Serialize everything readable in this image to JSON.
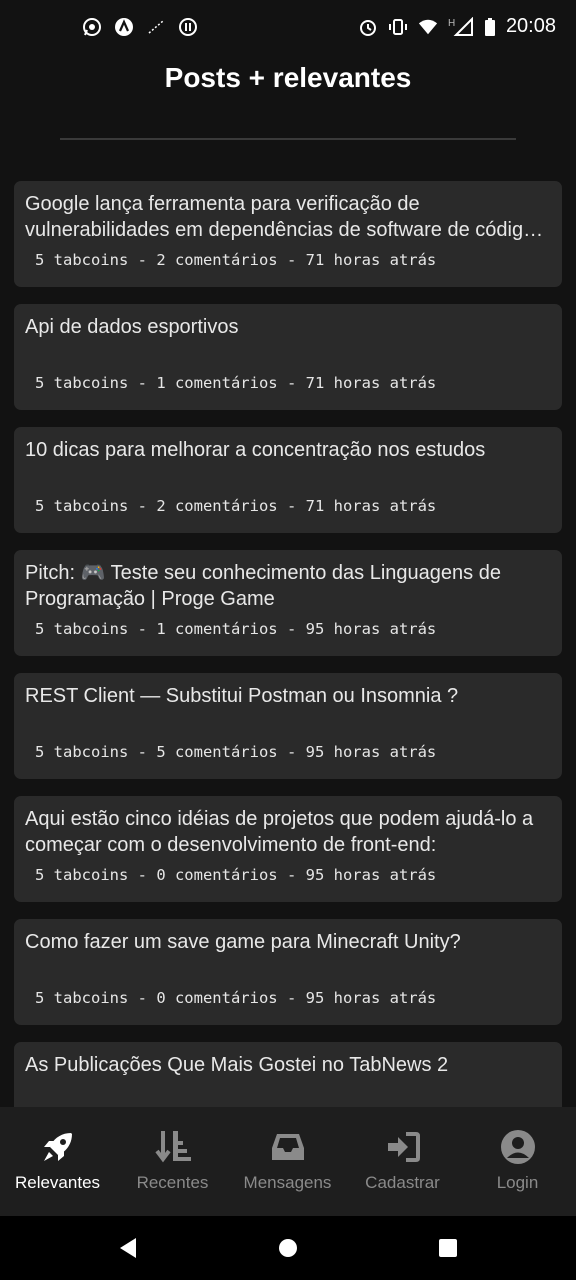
{
  "status_bar": {
    "time": "20:08",
    "left_icons": [
      "whatsapp-icon",
      "app-icon",
      "signal-dots-icon",
      "badge-icon"
    ],
    "right_icons": [
      "alarm-icon",
      "vibrate-icon",
      "wifi-icon",
      "cell-signal-icon",
      "battery-icon"
    ],
    "network_label": "H"
  },
  "page": {
    "title": "Posts + relevantes"
  },
  "posts": [
    {
      "title": "Google lança ferramenta para verificação de vulnerabilidades em dependências de software de código aberto",
      "meta": "5 tabcoins - 2 comentários - 71 horas atrás"
    },
    {
      "title": "Api de dados esportivos",
      "meta": "5 tabcoins - 1 comentários - 71 horas atrás"
    },
    {
      "title": "10 dicas para melhorar a concentração nos estudos",
      "meta": "5 tabcoins - 2 comentários - 71 horas atrás"
    },
    {
      "title": "Pitch: 🎮 Teste seu conhecimento das Linguagens de Programação | Proge Game",
      "meta": "5 tabcoins - 1 comentários - 95 horas atrás"
    },
    {
      "title": "REST Client — Substitui Postman ou Insomnia ?",
      "meta": "5 tabcoins - 5 comentários - 95 horas atrás"
    },
    {
      "title": "Aqui estão cinco idéias de projetos que podem ajudá-lo a começar com o desenvolvimento de front-end:",
      "meta": "5 tabcoins - 0 comentários - 95 horas atrás"
    },
    {
      "title": "Como fazer um save game para Minecraft Unity?",
      "meta": "5 tabcoins - 0 comentários - 95 horas atrás"
    },
    {
      "title": "As Publicações Que Mais Gostei no TabNews 2",
      "meta": ""
    }
  ],
  "bottom_nav": {
    "items": [
      {
        "label": "Relevantes",
        "icon": "rocket-icon",
        "active": true
      },
      {
        "label": "Recentes",
        "icon": "sort-descending-icon",
        "active": false
      },
      {
        "label": "Mensagens",
        "icon": "inbox-icon",
        "active": false
      },
      {
        "label": "Cadastrar",
        "icon": "sign-in-icon",
        "active": false
      },
      {
        "label": "Login",
        "icon": "user-circle-icon",
        "active": false
      }
    ]
  },
  "colors": {
    "background": "#121212",
    "card": "#2a2a2a",
    "nav_bg": "#1e1e1e",
    "active": "#ffffff",
    "inactive": "#8a8a8a"
  }
}
